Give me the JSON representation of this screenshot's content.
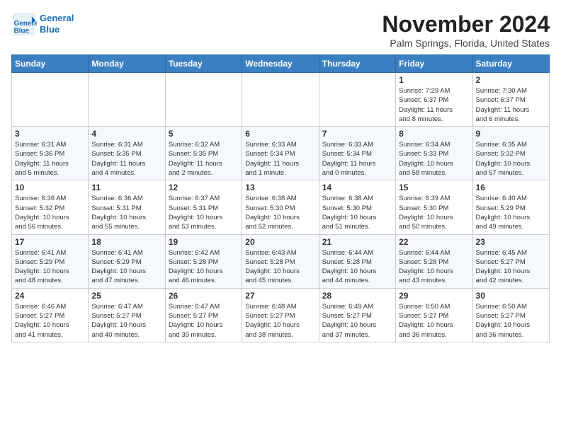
{
  "header": {
    "logo_line1": "General",
    "logo_line2": "Blue",
    "month": "November 2024",
    "location": "Palm Springs, Florida, United States"
  },
  "weekdays": [
    "Sunday",
    "Monday",
    "Tuesday",
    "Wednesday",
    "Thursday",
    "Friday",
    "Saturday"
  ],
  "weeks": [
    [
      {
        "day": "",
        "info": ""
      },
      {
        "day": "",
        "info": ""
      },
      {
        "day": "",
        "info": ""
      },
      {
        "day": "",
        "info": ""
      },
      {
        "day": "",
        "info": ""
      },
      {
        "day": "1",
        "info": "Sunrise: 7:29 AM\nSunset: 6:37 PM\nDaylight: 11 hours\nand 8 minutes."
      },
      {
        "day": "2",
        "info": "Sunrise: 7:30 AM\nSunset: 6:37 PM\nDaylight: 11 hours\nand 6 minutes."
      }
    ],
    [
      {
        "day": "3",
        "info": "Sunrise: 6:31 AM\nSunset: 5:36 PM\nDaylight: 11 hours\nand 5 minutes."
      },
      {
        "day": "4",
        "info": "Sunrise: 6:31 AM\nSunset: 5:35 PM\nDaylight: 11 hours\nand 4 minutes."
      },
      {
        "day": "5",
        "info": "Sunrise: 6:32 AM\nSunset: 5:35 PM\nDaylight: 11 hours\nand 2 minutes."
      },
      {
        "day": "6",
        "info": "Sunrise: 6:33 AM\nSunset: 5:34 PM\nDaylight: 11 hours\nand 1 minute."
      },
      {
        "day": "7",
        "info": "Sunrise: 6:33 AM\nSunset: 5:34 PM\nDaylight: 11 hours\nand 0 minutes."
      },
      {
        "day": "8",
        "info": "Sunrise: 6:34 AM\nSunset: 5:33 PM\nDaylight: 10 hours\nand 58 minutes."
      },
      {
        "day": "9",
        "info": "Sunrise: 6:35 AM\nSunset: 5:32 PM\nDaylight: 10 hours\nand 57 minutes."
      }
    ],
    [
      {
        "day": "10",
        "info": "Sunrise: 6:36 AM\nSunset: 5:32 PM\nDaylight: 10 hours\nand 56 minutes."
      },
      {
        "day": "11",
        "info": "Sunrise: 6:36 AM\nSunset: 5:31 PM\nDaylight: 10 hours\nand 55 minutes."
      },
      {
        "day": "12",
        "info": "Sunrise: 6:37 AM\nSunset: 5:31 PM\nDaylight: 10 hours\nand 53 minutes."
      },
      {
        "day": "13",
        "info": "Sunrise: 6:38 AM\nSunset: 5:30 PM\nDaylight: 10 hours\nand 52 minutes."
      },
      {
        "day": "14",
        "info": "Sunrise: 6:38 AM\nSunset: 5:30 PM\nDaylight: 10 hours\nand 51 minutes."
      },
      {
        "day": "15",
        "info": "Sunrise: 6:39 AM\nSunset: 5:30 PM\nDaylight: 10 hours\nand 50 minutes."
      },
      {
        "day": "16",
        "info": "Sunrise: 6:40 AM\nSunset: 5:29 PM\nDaylight: 10 hours\nand 49 minutes."
      }
    ],
    [
      {
        "day": "17",
        "info": "Sunrise: 6:41 AM\nSunset: 5:29 PM\nDaylight: 10 hours\nand 48 minutes."
      },
      {
        "day": "18",
        "info": "Sunrise: 6:41 AM\nSunset: 5:29 PM\nDaylight: 10 hours\nand 47 minutes."
      },
      {
        "day": "19",
        "info": "Sunrise: 6:42 AM\nSunset: 5:28 PM\nDaylight: 10 hours\nand 46 minutes."
      },
      {
        "day": "20",
        "info": "Sunrise: 6:43 AM\nSunset: 5:28 PM\nDaylight: 10 hours\nand 45 minutes."
      },
      {
        "day": "21",
        "info": "Sunrise: 6:44 AM\nSunset: 5:28 PM\nDaylight: 10 hours\nand 44 minutes."
      },
      {
        "day": "22",
        "info": "Sunrise: 6:44 AM\nSunset: 5:28 PM\nDaylight: 10 hours\nand 43 minutes."
      },
      {
        "day": "23",
        "info": "Sunrise: 6:45 AM\nSunset: 5:27 PM\nDaylight: 10 hours\nand 42 minutes."
      }
    ],
    [
      {
        "day": "24",
        "info": "Sunrise: 6:46 AM\nSunset: 5:27 PM\nDaylight: 10 hours\nand 41 minutes."
      },
      {
        "day": "25",
        "info": "Sunrise: 6:47 AM\nSunset: 5:27 PM\nDaylight: 10 hours\nand 40 minutes."
      },
      {
        "day": "26",
        "info": "Sunrise: 6:47 AM\nSunset: 5:27 PM\nDaylight: 10 hours\nand 39 minutes."
      },
      {
        "day": "27",
        "info": "Sunrise: 6:48 AM\nSunset: 5:27 PM\nDaylight: 10 hours\nand 38 minutes."
      },
      {
        "day": "28",
        "info": "Sunrise: 6:49 AM\nSunset: 5:27 PM\nDaylight: 10 hours\nand 37 minutes."
      },
      {
        "day": "29",
        "info": "Sunrise: 6:50 AM\nSunset: 5:27 PM\nDaylight: 10 hours\nand 36 minutes."
      },
      {
        "day": "30",
        "info": "Sunrise: 6:50 AM\nSunset: 5:27 PM\nDaylight: 10 hours\nand 36 minutes."
      }
    ]
  ]
}
